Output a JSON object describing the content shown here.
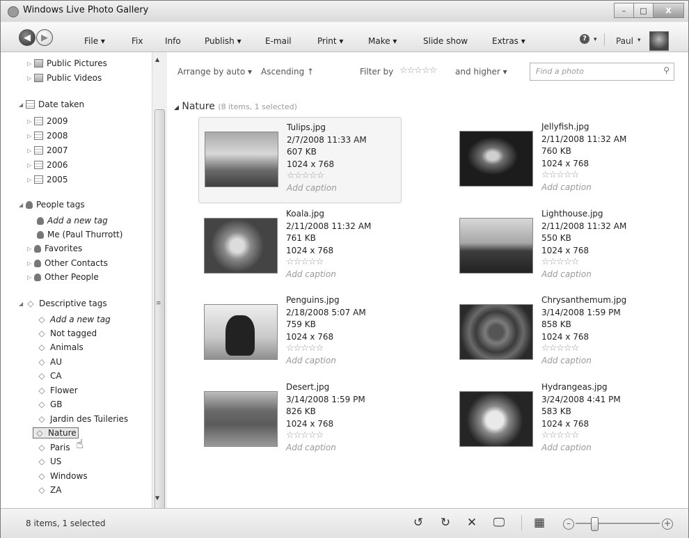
{
  "window": {
    "title": "Windows Live Photo Gallery",
    "buttons": {
      "minimize": "–",
      "maximize": "□",
      "close": "X"
    }
  },
  "menu": {
    "items": [
      "File ▾",
      "Fix",
      "Info",
      "Publish ▾",
      "E-mail",
      "Print ▾",
      "Make ▾",
      "Slide show",
      "Extras ▾"
    ],
    "user": "Paul",
    "caret": "▾",
    "help": "?"
  },
  "nav": {
    "public_pictures": "Public Pictures",
    "public_videos": "Public Videos",
    "date_taken": "Date taken",
    "years": [
      "2009",
      "2008",
      "2007",
      "2006",
      "2005"
    ],
    "people_tags": "People tags",
    "add_new_person_tag": "Add a new tag",
    "me": "Me (Paul Thurrott)",
    "favorites": "Favorites",
    "other_contacts": "Other Contacts",
    "other_people": "Other People",
    "descriptive_tags": "Descriptive tags",
    "add_new_tag": "Add a new tag",
    "not_tagged": "Not tagged",
    "tags": [
      "Animals",
      "AU",
      "CA",
      "Flower",
      "GB",
      "Jardin des Tuileries",
      "Nature",
      "Paris",
      "US",
      "Windows",
      "ZA"
    ],
    "selected_tag": "Nature"
  },
  "toolbar": {
    "arrange": "Arrange by auto ▾",
    "ascending": "Ascending ↑",
    "filter_by": "Filter by",
    "stars": "☆☆☆☆☆",
    "and_higher": "and higher ▾",
    "search_placeholder": "Find a photo"
  },
  "group": {
    "name": "Nature",
    "count": "(8 items, 1 selected)"
  },
  "photos": [
    {
      "name": "Tulips.jpg",
      "date": "2/7/2008 11:33 AM",
      "size": "607 KB",
      "dims": "1024 x 768",
      "rating": "☆☆☆☆☆",
      "caption": "Add caption",
      "selected": true
    },
    {
      "name": "Jellyfish.jpg",
      "date": "2/11/2008 11:32 AM",
      "size": "760 KB",
      "dims": "1024 x 768",
      "rating": "☆☆☆☆☆",
      "caption": "Add caption"
    },
    {
      "name": "Koala.jpg",
      "date": "2/11/2008 11:32 AM",
      "size": "761 KB",
      "dims": "1024 x 768",
      "rating": "☆☆☆☆☆",
      "caption": "Add caption"
    },
    {
      "name": "Lighthouse.jpg",
      "date": "2/11/2008 11:32 AM",
      "size": "550 KB",
      "dims": "1024 x 768",
      "rating": "☆☆☆☆☆",
      "caption": "Add caption"
    },
    {
      "name": "Penguins.jpg",
      "date": "2/18/2008 5:07 AM",
      "size": "759 KB",
      "dims": "1024 x 768",
      "rating": "☆☆☆☆☆",
      "caption": "Add caption"
    },
    {
      "name": "Chrysanthemum.jpg",
      "date": "3/14/2008 1:59 PM",
      "size": "858 KB",
      "dims": "1024 x 768",
      "rating": "☆☆☆☆☆",
      "caption": "Add caption"
    },
    {
      "name": "Desert.jpg",
      "date": "3/14/2008 1:59 PM",
      "size": "826 KB",
      "dims": "1024 x 768",
      "rating": "☆☆☆☆☆",
      "caption": "Add caption"
    },
    {
      "name": "Hydrangeas.jpg",
      "date": "3/24/2008 4:41 PM",
      "size": "583 KB",
      "dims": "1024 x 768",
      "rating": "☆☆☆☆☆",
      "caption": "Add caption"
    }
  ],
  "status": {
    "text": "8 items, 1 selected",
    "icons": {
      "rotate_left": "↺",
      "rotate_right": "↻",
      "delete": "✕",
      "slideshow": "🖵",
      "view": "▦",
      "zoom_out": "–",
      "zoom_in": "+"
    }
  }
}
